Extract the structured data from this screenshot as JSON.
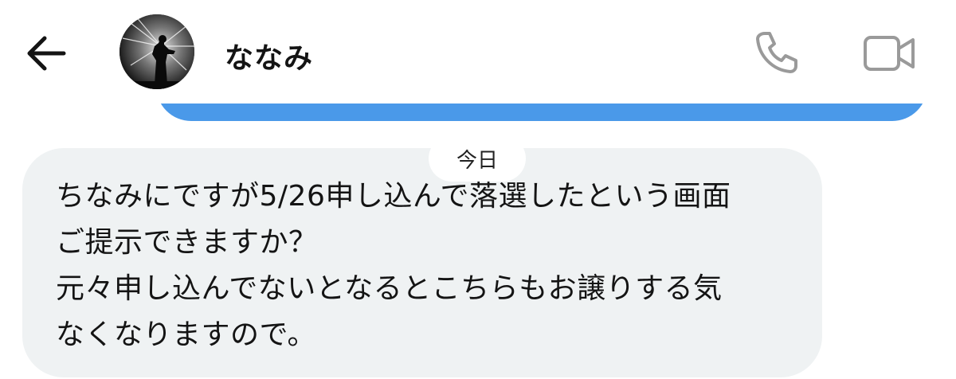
{
  "header": {
    "contact_name": "ななみ",
    "back_icon": "arrow-left-icon",
    "call_icon": "phone-icon",
    "video_icon": "video-camera-icon"
  },
  "date_separator": {
    "label": "今日"
  },
  "messages": [
    {
      "direction": "received",
      "lines": [
        "ちなみにですが5/26申し込んで落選したという画面",
        "ご提示できますか？",
        "元々申し込んでないとなるとこちらもお譲りする気",
        "なくなりますので。"
      ]
    }
  ],
  "colors": {
    "sent_bubble": "#4a99e9",
    "received_bubble": "#eff2f3",
    "icon_gray": "#9a9a9a",
    "text": "#141414"
  }
}
